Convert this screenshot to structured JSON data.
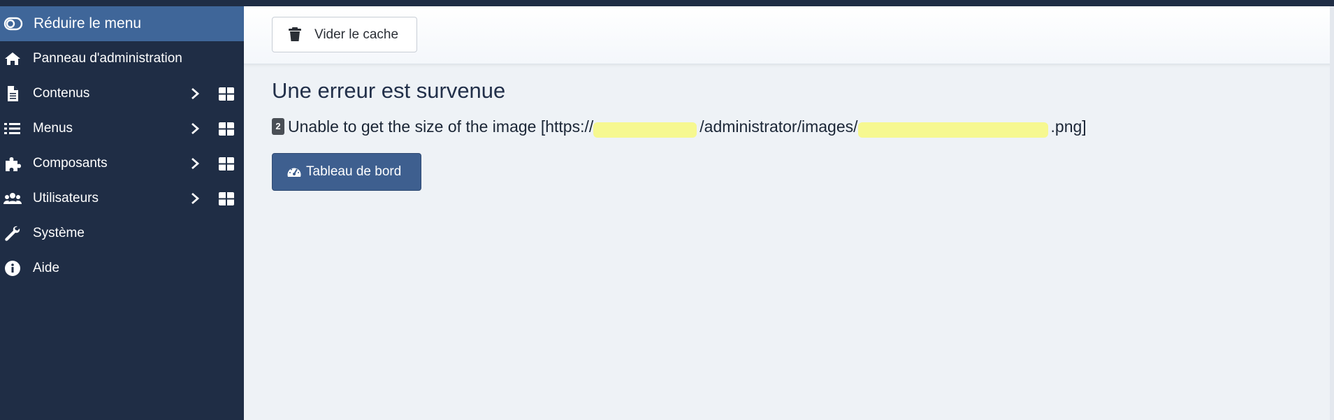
{
  "sidebar": {
    "toggle_label": "Réduire le menu",
    "items": [
      {
        "label": "Panneau d'administration",
        "icon": "home-icon"
      },
      {
        "label": "Contenus",
        "icon": "file-icon"
      },
      {
        "label": "Menus",
        "icon": "list-icon"
      },
      {
        "label": "Composants",
        "icon": "puzzle-icon"
      },
      {
        "label": "Utilisateurs",
        "icon": "users-icon"
      },
      {
        "label": "Système",
        "icon": "wrench-icon"
      },
      {
        "label": "Aide",
        "icon": "info-icon"
      }
    ]
  },
  "toolbar": {
    "clear_cache_label": "Vider le cache"
  },
  "error": {
    "title": "Une erreur est survenue",
    "badge": "2",
    "message_prefix": "Unable to get the size of the image [https://",
    "message_middle": "/administrator/images/",
    "message_suffix": ".png]"
  },
  "dashboard_button_label": "Tableau de bord",
  "colors": {
    "sidebar_bg": "#1f2d45",
    "toggle_bg": "#3f6699",
    "content_bg": "#eef2f6",
    "primary_button": "#3e5f8f",
    "redaction": "#f7f97e"
  }
}
